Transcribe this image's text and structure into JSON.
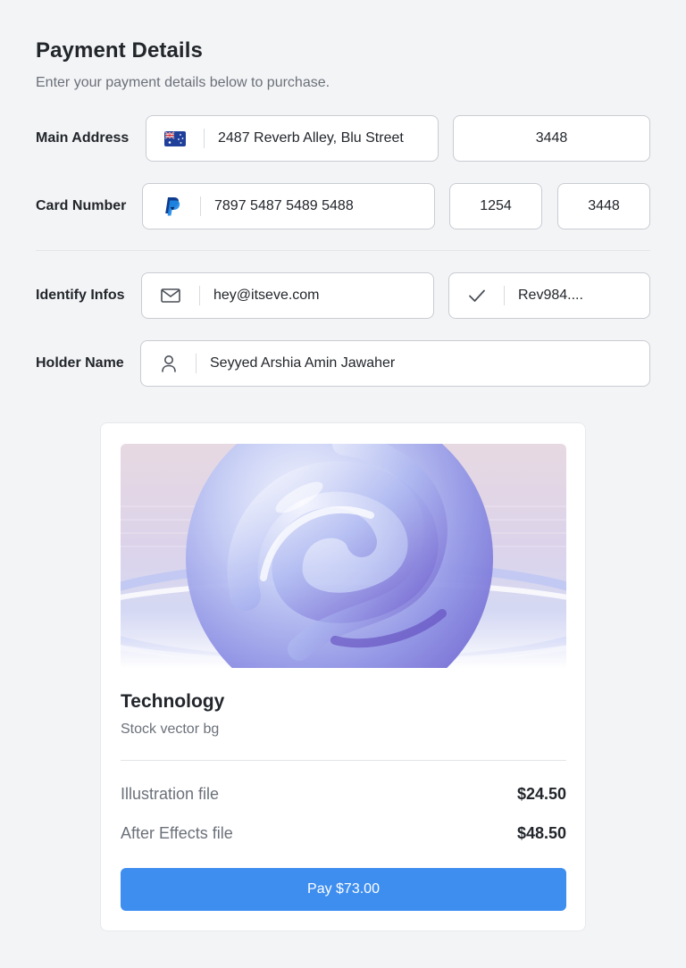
{
  "header": {
    "title": "Payment Details",
    "subtitle": "Enter your payment details below to purchase."
  },
  "form": {
    "main_address": {
      "label": "Main Address",
      "address": "2487 Reverb Alley, Blu Street",
      "address_icon": "flag-icon",
      "postal": "3448"
    },
    "card_number": {
      "label": "Card Number",
      "number": "7897 5487 5489 5488",
      "card_icon": "paypal-icon",
      "expiry": "1254",
      "cvv": "3448"
    },
    "identify_infos": {
      "label": "Identify Infos",
      "email": "hey@itseve.com",
      "email_icon": "mail-icon",
      "code": "Rev984....",
      "code_icon": "check-icon"
    },
    "holder_name": {
      "label": "Holder Name",
      "name": "Seyyed Arshia Amin Jawaher",
      "name_icon": "user-icon"
    }
  },
  "product": {
    "title": "Technology",
    "subtitle": "Stock vector bg",
    "items": [
      {
        "label": "Illustration file",
        "price": "$24.50"
      },
      {
        "label": "After Effects file",
        "price": "$48.50"
      }
    ],
    "pay_label": "Pay $73.00"
  },
  "colors": {
    "accent": "#3e8ef0",
    "background": "#f3f4f6",
    "card": "#ffffff"
  }
}
